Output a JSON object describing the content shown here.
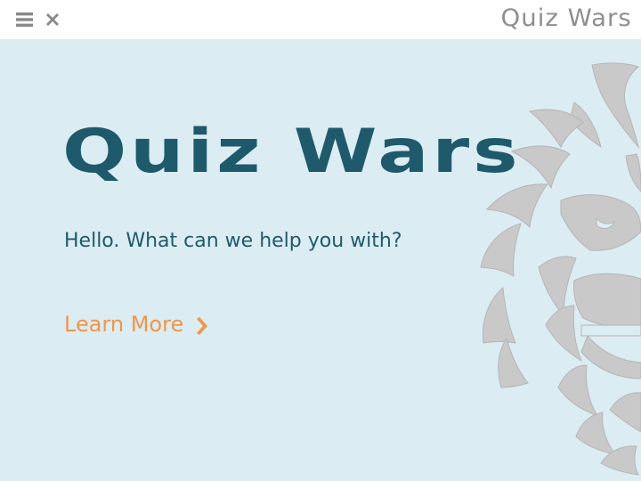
{
  "header": {
    "menu_icon": "hamburger-menu-icon",
    "close_icon": "close-x-icon",
    "brand": "Quiz Wars"
  },
  "hero": {
    "title": "Quiz Wars",
    "subtitle": "Hello. What can we help you with?",
    "cta_label": "Learn More",
    "cta_icon": "chevron-right-icon",
    "emblem_icon": "wookiee-emblem-icon"
  },
  "colors": {
    "hero_bg": "#dcecf3",
    "title": "#1e5a6b",
    "accent": "#f0954a",
    "brand_gray": "#8f8f8f"
  }
}
